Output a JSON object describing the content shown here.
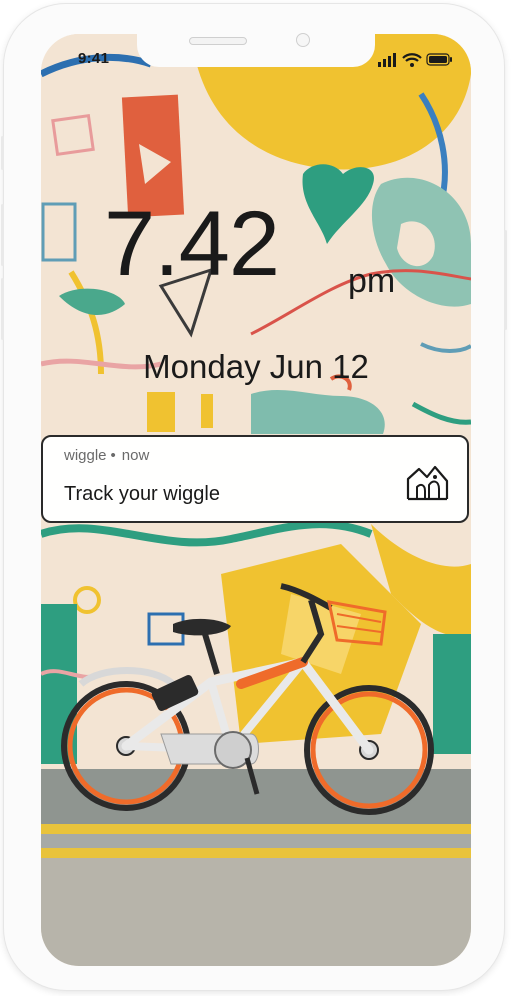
{
  "status_bar": {
    "time": "9:41"
  },
  "lock_screen": {
    "clock_time": "7.42",
    "clock_period": "pm",
    "date": "Monday Jun 12"
  },
  "notification": {
    "app_name": "wiggle",
    "time_label": "now",
    "title": "Track your wiggle",
    "icon": "wiggle-logo-icon"
  },
  "colors": {
    "wall": "#f3e4d3",
    "mustard": "#f0c230",
    "teal": "#2e9e80",
    "coral": "#e0603e",
    "bike_orange": "#ef6b2a"
  }
}
